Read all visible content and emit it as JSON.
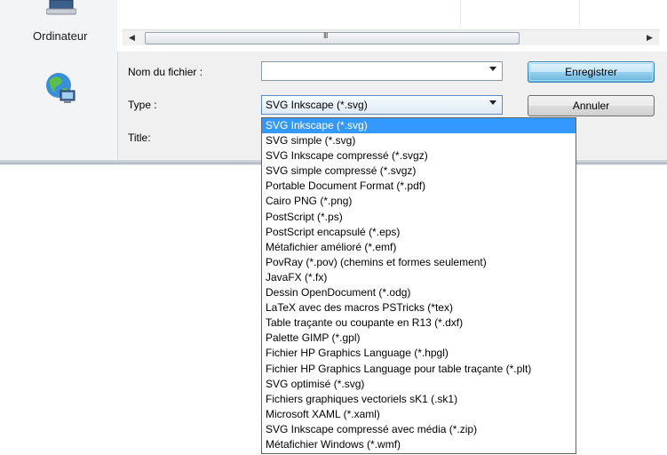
{
  "places": {
    "computer_label": "Ordinateur"
  },
  "form": {
    "filename_label": "Nom du fichier :",
    "filename_value": "",
    "type_label": "Type :",
    "type_value": "SVG Inkscape (*.svg)",
    "title_label": "Title:"
  },
  "buttons": {
    "save": "Enregistrer",
    "cancel": "Annuler"
  },
  "scrollbar": {
    "grip": "III"
  },
  "file_types": [
    "SVG Inkscape (*.svg)",
    "SVG simple (*.svg)",
    "SVG Inkscape compressé (*.svgz)",
    "SVG simple compressé (*.svgz)",
    "Portable Document Format (*.pdf)",
    "Cairo PNG (*.png)",
    "PostScript (*.ps)",
    "PostScript encapsulé (*.eps)",
    "Métafichier amélioré (*.emf)",
    "PovRay (*.pov) (chemins et formes seulement)",
    "JavaFX (*.fx)",
    "Dessin OpenDocument (*.odg)",
    "LaTeX avec des macros PSTricks (*tex)",
    "Table traçante ou coupante en R13 (*.dxf)",
    "Palette GIMP (*.gpl)",
    "Fichier HP Graphics Language (*.hpgl)",
    "Fichier HP Graphics Language pour table traçante (*.plt)",
    "SVG optimisé (*.svg)",
    "Fichiers graphiques vectoriels sK1 (.sk1)",
    "Microsoft XAML (*.xaml)",
    "SVG Inkscape compressé avec média (*.zip)",
    "Métafichier Windows (*.wmf)"
  ],
  "selected_index": 0
}
